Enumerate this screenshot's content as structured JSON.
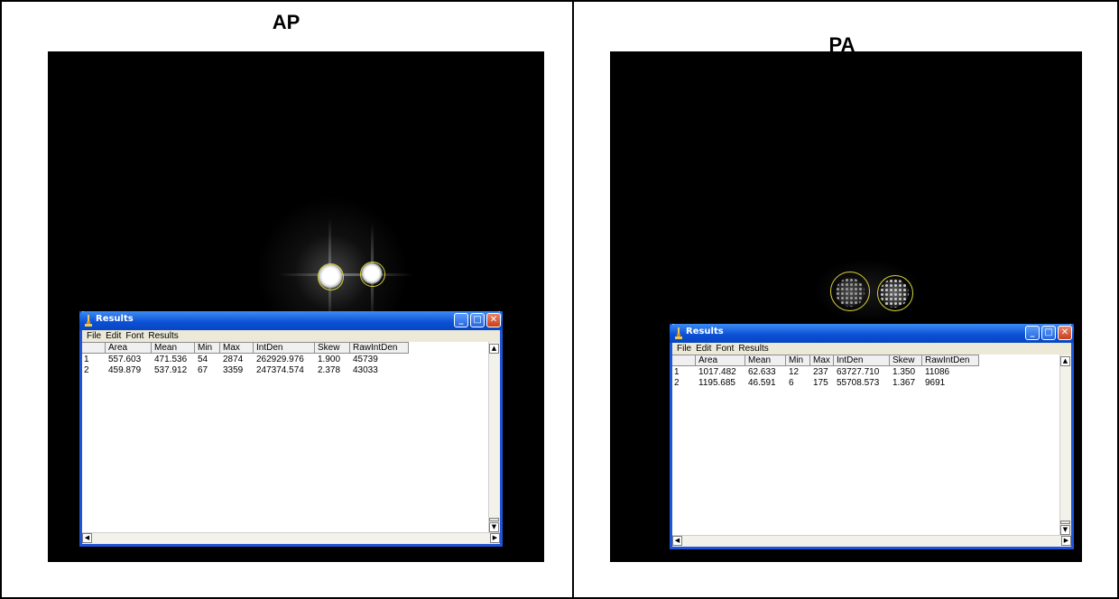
{
  "panels": [
    {
      "label": "AP",
      "window": {
        "title": "Results",
        "menu": [
          "File",
          "Edit",
          "Font",
          "Results"
        ],
        "columns": [
          "Area",
          "Mean",
          "Min",
          "Max",
          "IntDen",
          "Skew",
          "RawIntDen"
        ],
        "rows": [
          {
            "index": "1",
            "cells": [
              "557.603",
              "471.536",
              "54",
              "2874",
              "262929.976",
              "1.900",
              "45739"
            ]
          },
          {
            "index": "2",
            "cells": [
              "459.879",
              "537.912",
              "67",
              "3359",
              "247374.574",
              "2.378",
              "43033"
            ]
          }
        ]
      }
    },
    {
      "label": "PA",
      "window": {
        "title": "Results",
        "menu": [
          "File",
          "Edit",
          "Font",
          "Results"
        ],
        "columns": [
          "Area",
          "Mean",
          "Min",
          "Max",
          "IntDen",
          "Skew",
          "RawIntDen"
        ],
        "rows": [
          {
            "index": "1",
            "cells": [
              "1017.482",
              "62.633",
              "12",
              "237",
              "63727.710",
              "1.350",
              "11086"
            ]
          },
          {
            "index": "2",
            "cells": [
              "1195.685",
              "46.591",
              "6",
              "175",
              "55708.573",
              "1.367",
              "9691"
            ]
          }
        ]
      }
    }
  ],
  "icons": {
    "window": "imagej-microscope-icon",
    "minimize": "minimize-icon",
    "maximize": "maximize-icon",
    "close": "close-icon",
    "scroll_up": "scroll-up-icon",
    "scroll_down": "scroll-down-icon",
    "scroll_left": "scroll-left-icon",
    "scroll_right": "scroll-right-icon"
  },
  "colors": {
    "roi_outline": "#d8d23a",
    "titlebar": "#0a4fd4",
    "image_background": "#000000"
  }
}
